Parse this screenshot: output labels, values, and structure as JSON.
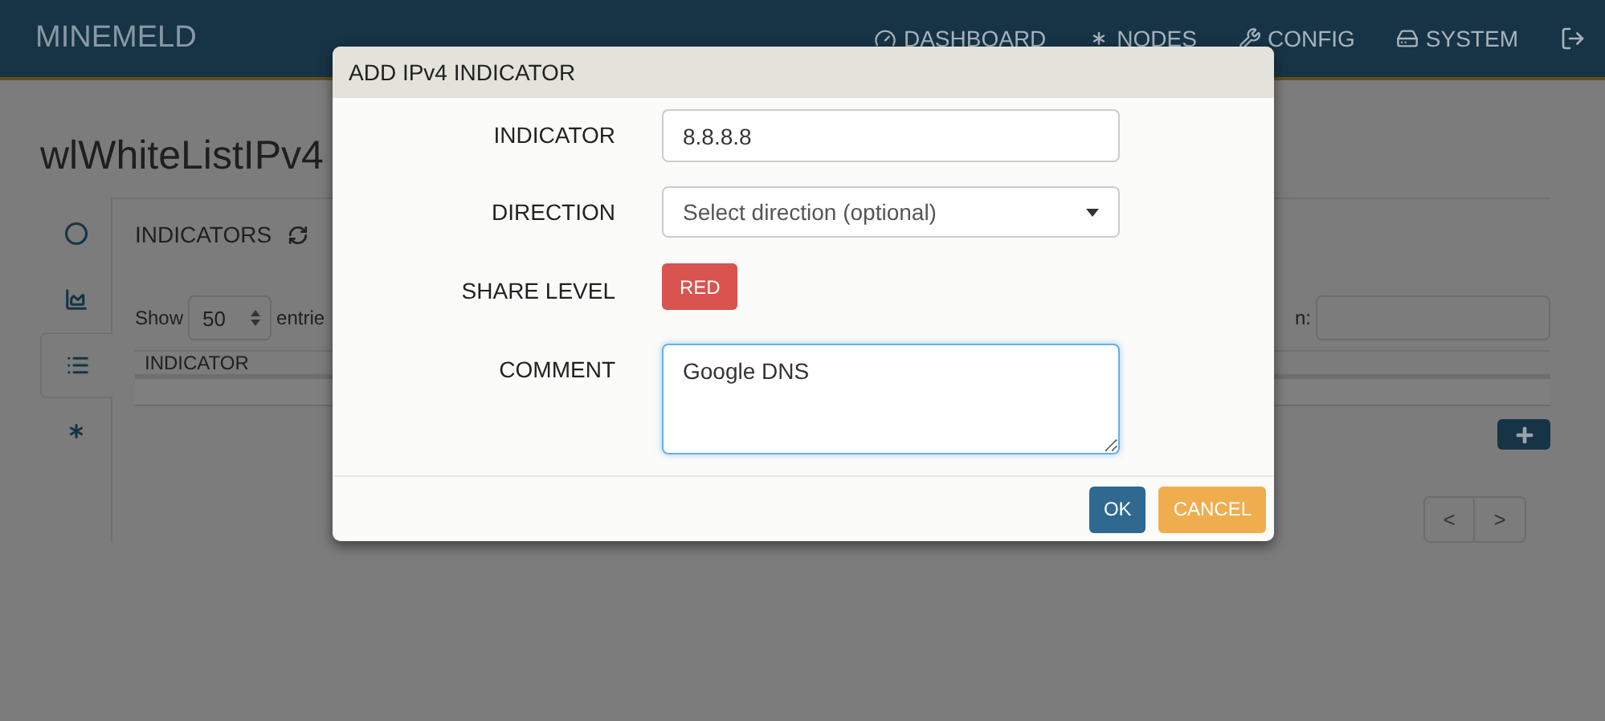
{
  "navbar": {
    "brand": "MINEMELD",
    "items": [
      {
        "label": "DASHBOARD"
      },
      {
        "label": "NODES"
      },
      {
        "label": "CONFIG"
      },
      {
        "label": "SYSTEM"
      }
    ]
  },
  "page": {
    "title": "wlWhiteListIPv4",
    "side_tabs": [
      {
        "selected": false
      },
      {
        "selected": false
      },
      {
        "selected": true
      },
      {
        "selected": false
      }
    ],
    "panel": {
      "title": "INDICATORS",
      "show_label": "Show",
      "page_size": "50",
      "entries_label": "entrie",
      "search_label": "n:",
      "columns": [
        "INDICATOR"
      ],
      "pager": [
        "<",
        ">"
      ]
    }
  },
  "dialog": {
    "title": "ADD IPv4 INDICATOR",
    "fields": [
      {
        "kind": "input",
        "label": "INDICATOR",
        "value": "8.8.8.8"
      },
      {
        "kind": "select",
        "label": "DIRECTION",
        "placeholder": "Select direction (optional)"
      },
      {
        "kind": "badge",
        "label": "SHARE LEVEL",
        "value": "RED",
        "color": "#d9534f"
      },
      {
        "kind": "textarea",
        "label": "COMMENT",
        "value": "Google DNS",
        "focused": true
      }
    ],
    "buttons": [
      {
        "label": "OK",
        "kind": "primary"
      },
      {
        "label": "CANCEL",
        "kind": "warning"
      }
    ]
  }
}
